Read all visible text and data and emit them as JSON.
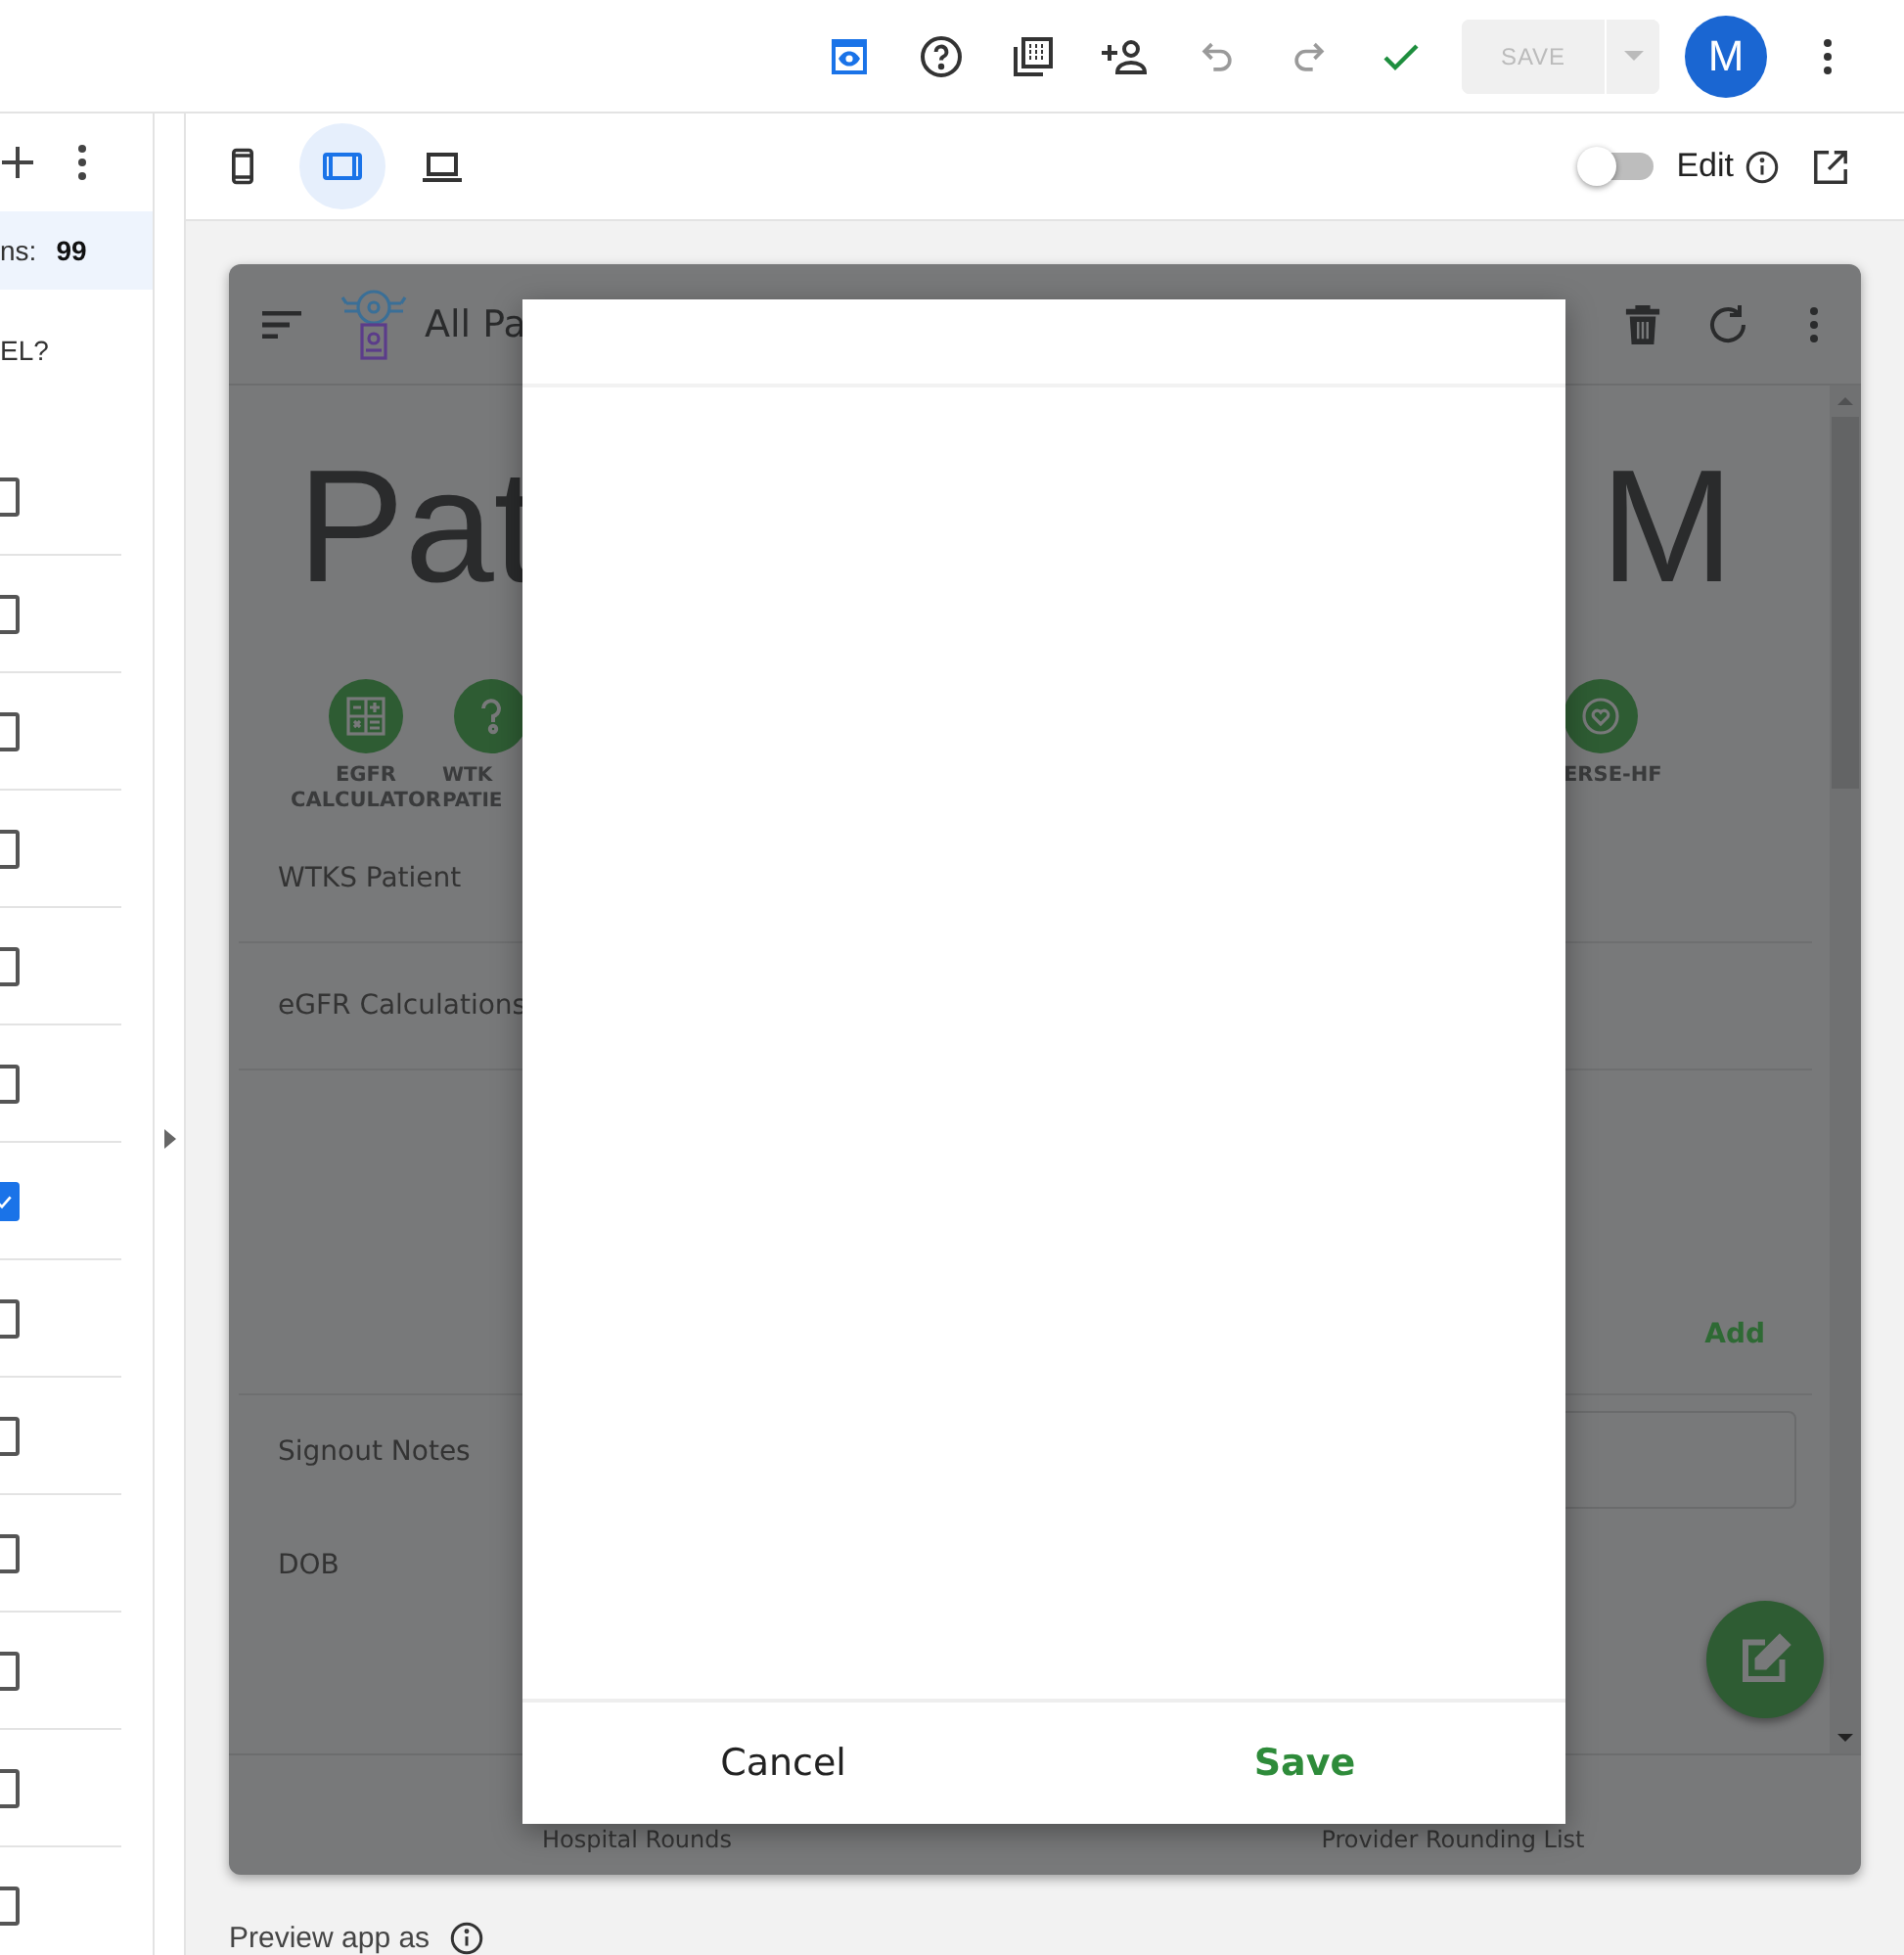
{
  "top_toolbar": [
    {
      "kind": "preview",
      "selected": true,
      "disabled": false
    },
    {
      "kind": "help",
      "selected": false,
      "disabled": false
    },
    {
      "kind": "pages",
      "selected": false,
      "disabled": false
    },
    {
      "kind": "share",
      "selected": false,
      "disabled": false
    },
    {
      "kind": "undo",
      "selected": false,
      "disabled": true
    },
    {
      "kind": "redo",
      "selected": false,
      "disabled": true
    },
    {
      "kind": "saved",
      "selected": false,
      "disabled": false
    }
  ],
  "save_button": {
    "label": "SAVE",
    "disabled": true
  },
  "avatar": {
    "initial": "M"
  },
  "left_panel": {
    "count_label": "ns:",
    "count": "99",
    "question": "EL?",
    "rows": [
      {
        "checked": false
      },
      {
        "checked": false
      },
      {
        "checked": false
      },
      {
        "checked": false
      },
      {
        "checked": false
      },
      {
        "checked": false
      },
      {
        "checked": true
      },
      {
        "checked": false
      },
      {
        "checked": false
      },
      {
        "checked": false
      },
      {
        "checked": false
      },
      {
        "checked": false
      },
      {
        "checked": false
      }
    ]
  },
  "device_modes": [
    {
      "kind": "phone",
      "selected": false
    },
    {
      "kind": "tablet",
      "selected": true
    },
    {
      "kind": "laptop",
      "selected": false
    }
  ],
  "edit_toggle": {
    "label": "Edit",
    "on": false
  },
  "app": {
    "title": "All Pa",
    "heading_left": "Pat",
    "heading_right": "M",
    "actions": [
      {
        "kind": "calculator",
        "lines": [
          "EGFR",
          "CALCULATOR"
        ]
      },
      {
        "kind": "question",
        "lines": [
          "WTK",
          "PATIE"
        ]
      },
      {
        "kind": "heart",
        "lines": [
          "ERSE-HF"
        ]
      }
    ],
    "fields": [
      {
        "label": "WTKS Patient"
      },
      {
        "label": "eGFR Calculations"
      }
    ],
    "add_label": "Add",
    "lower_fields": [
      {
        "label": "Signout Notes",
        "kind": "input"
      },
      {
        "label": "DOB",
        "kind": "text"
      }
    ],
    "nav": [
      "Hospital Rounds",
      "Provider Rounding List"
    ]
  },
  "dialog": {
    "cancel": "Cancel",
    "save": "Save"
  },
  "preview_label": "Preview app as"
}
